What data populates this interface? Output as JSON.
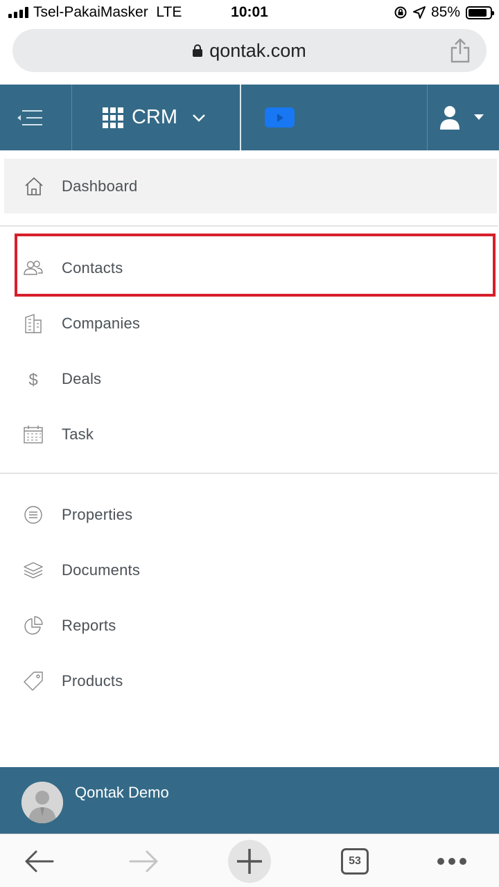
{
  "status_bar": {
    "carrier": "Tsel-PakaiMasker",
    "network": "LTE",
    "time": "10:01",
    "battery": "85%",
    "battery_level": 0.85
  },
  "browser": {
    "url": "qontak.com",
    "tab_count": "53"
  },
  "header": {
    "app_switch_label": "CRM",
    "colors": {
      "header_bg": "#346a87",
      "video_button": "#1877f2"
    }
  },
  "sidebar": {
    "items": [
      {
        "label": "Dashboard",
        "icon": "home-icon"
      },
      {
        "label": "Contacts",
        "icon": "users-icon"
      },
      {
        "label": "Companies",
        "icon": "building-icon"
      },
      {
        "label": "Deals",
        "icon": "dollar-icon"
      },
      {
        "label": "Task",
        "icon": "calendar-icon"
      },
      {
        "label": "Properties",
        "icon": "list-circle-icon"
      },
      {
        "label": "Documents",
        "icon": "layers-icon"
      },
      {
        "label": "Reports",
        "icon": "pie-chart-icon"
      },
      {
        "label": "Products",
        "icon": "tag-icon"
      }
    ],
    "highlight_color": "#d71f2b"
  },
  "footer": {
    "user_name": "Qontak Demo"
  }
}
